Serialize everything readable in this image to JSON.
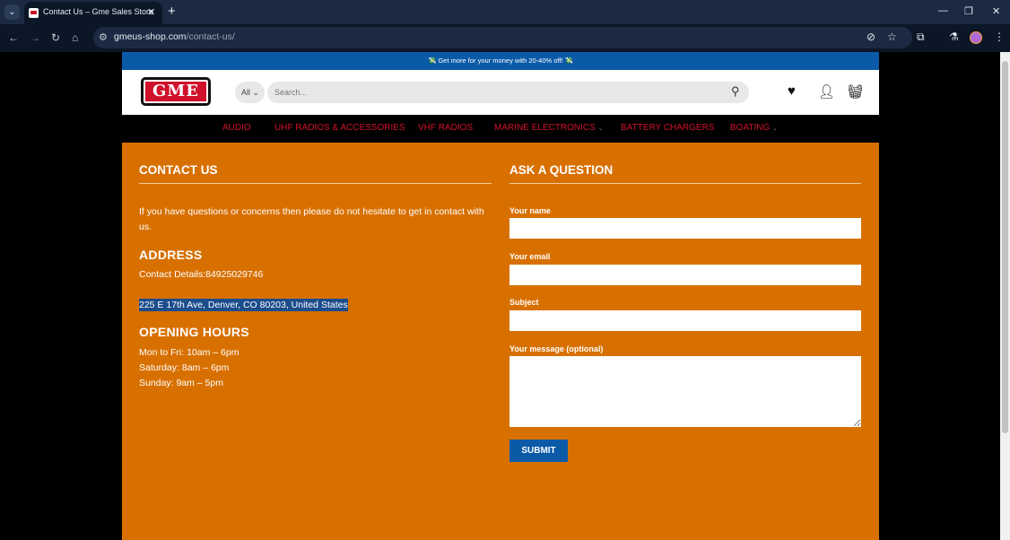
{
  "browser": {
    "tab_title": "Contact Us – Gme Sales Store",
    "url_host": "gmeus-shop.com",
    "url_path": "/contact-us/"
  },
  "promo": {
    "text": "💸 Get more for your money with 20-40% off! 💸"
  },
  "header": {
    "logo_text": "GME",
    "category_select": "All",
    "search_placeholder": "Search..."
  },
  "nav": {
    "items": [
      {
        "label": "AUDIO",
        "caret": ""
      },
      {
        "label": "UHF RADIOS & ACCESSORIES",
        "caret": ""
      },
      {
        "label": "VHF RADIOS",
        "caret": ""
      },
      {
        "label": "MARINE ELECTRONICS",
        "caret": "⌄"
      },
      {
        "label": "BATTERY CHARGERS",
        "caret": ""
      },
      {
        "label": "BOATING",
        "caret": "⌄"
      }
    ]
  },
  "contact": {
    "title": "CONTACT US",
    "intro": "If you have questions or concerns then please do not hesitate to get in contact with us.",
    "address_title": "ADDRESS",
    "contact_details": "Contact Details:84925029746",
    "address": "225 E 17th Ave, Denver, CO 80203, United States",
    "hours_title": "OPENING HOURS",
    "hours": [
      "Mon to Fri: 10am – 6pm",
      "Saturday: 8am – 6pm",
      "Sunday: 9am – 5pm"
    ]
  },
  "form": {
    "title": "ASK A QUESTION",
    "name_label": "Your name",
    "email_label": "Your email",
    "subject_label": "Subject",
    "message_label": "Your message (optional)",
    "submit_label": "SUBMIT",
    "name_value": "",
    "email_value": "",
    "subject_value": "",
    "message_value": ""
  },
  "colors": {
    "accent_orange": "#d87000",
    "brand_red": "#d0112b",
    "brand_blue": "#0b5aa8"
  }
}
